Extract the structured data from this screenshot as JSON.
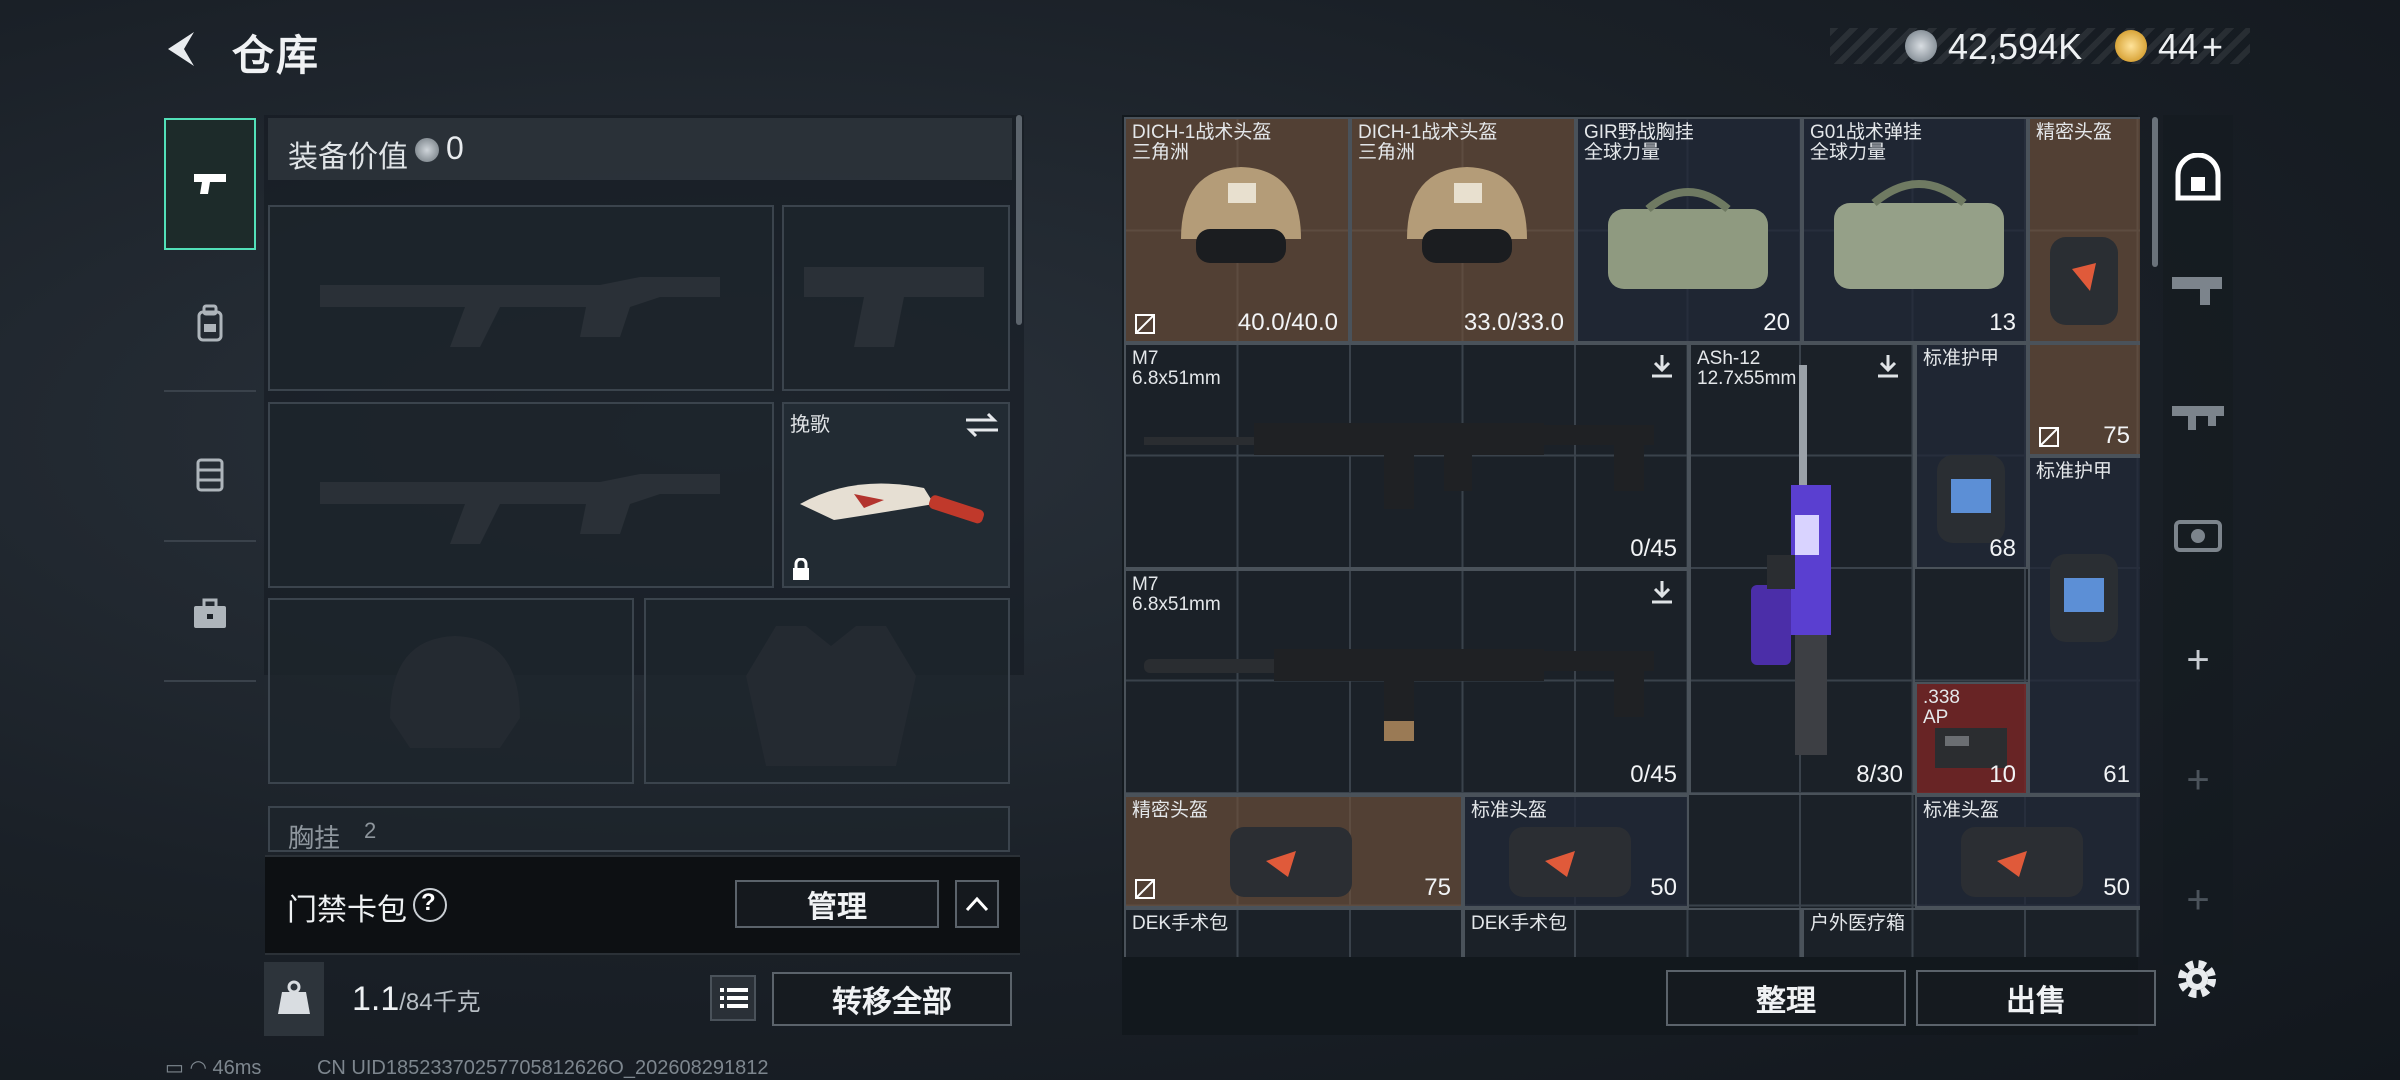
{
  "header": {
    "title": "仓库",
    "currency": [
      {
        "icon": "silver-coin-icon",
        "value": "42,594K"
      },
      {
        "icon": "gold-coin-icon",
        "value": "44"
      }
    ],
    "add_label": "+"
  },
  "left_nav": [
    {
      "icon": "pistol-icon",
      "active": true
    },
    {
      "icon": "backpack-icon",
      "active": false
    },
    {
      "icon": "vest-icon",
      "active": false
    },
    {
      "icon": "briefcase-icon",
      "active": false
    }
  ],
  "equipment": {
    "value_label": "装备价值",
    "value": "0",
    "knife_label": "挽歌",
    "chest_label": "胸挂",
    "chest_count": "2"
  },
  "keycard": {
    "label": "门禁卡包",
    "help": "?",
    "manage_label": "管理"
  },
  "weight": {
    "current": "1.1",
    "max": "/84千克"
  },
  "transfer_all_label": "转移全部",
  "status": {
    "ping": "46ms",
    "uid": "CN UID18523370257705812626O_202608291812"
  },
  "storage": {
    "items": [
      {
        "name": "DICH-1战术头盔",
        "sub": "三角洲",
        "value": "40.0/40.0",
        "color": "brown"
      },
      {
        "name": "DICH-1战术头盔",
        "sub": "三角洲",
        "value": "33.0/33.0",
        "color": "brown"
      },
      {
        "name": "GIR野战胸挂",
        "sub": "全球力量",
        "value": "20",
        "color": "dark"
      },
      {
        "name": "G01战术弹挂",
        "sub": "全球力量",
        "value": "13",
        "color": "dark"
      },
      {
        "name": "精密头盔",
        "sub": "",
        "value": "75",
        "color": "brown"
      },
      {
        "name": "M7",
        "sub": "6.8x51mm",
        "value": "0/45",
        "color": "plain"
      },
      {
        "name": "ASh-12",
        "sub": "12.7x55mm",
        "value": "8/30",
        "color": "plain"
      },
      {
        "name": "标准护甲",
        "sub": "",
        "value": "68",
        "color": "dark"
      },
      {
        "name": "标准护甲",
        "sub": "",
        "value": "61",
        "color": "dark"
      },
      {
        "name": "M7",
        "sub": "6.8x51mm",
        "value": "0/45",
        "color": "plain"
      },
      {
        "name": ".338",
        "sub": "AP",
        "value": "10",
        "color": "red"
      },
      {
        "name": "精密头盔",
        "sub": "",
        "value": "75",
        "color": "brown"
      },
      {
        "name": "标准头盔",
        "sub": "",
        "value": "50",
        "color": "dark"
      },
      {
        "name": "标准头盔",
        "sub": "",
        "value": "50",
        "color": "dark"
      },
      {
        "name": "DEK手术包",
        "sub": "",
        "value": "",
        "color": "plain"
      },
      {
        "name": "DEK手术包",
        "sub": "",
        "value": "",
        "color": "plain"
      },
      {
        "name": "户外医疗箱",
        "sub": "",
        "value": "",
        "color": "plain"
      }
    ]
  },
  "actions": {
    "sort_label": "整理",
    "sell_label": "出售"
  },
  "right_nav": [
    {
      "icon": "all-items-icon"
    },
    {
      "icon": "weapon-category-icon"
    },
    {
      "icon": "rifle-category-icon"
    },
    {
      "icon": "equipment-category-icon"
    },
    {
      "icon": "add-icon"
    },
    {
      "icon": "add-icon"
    },
    {
      "icon": "add-icon"
    }
  ]
}
